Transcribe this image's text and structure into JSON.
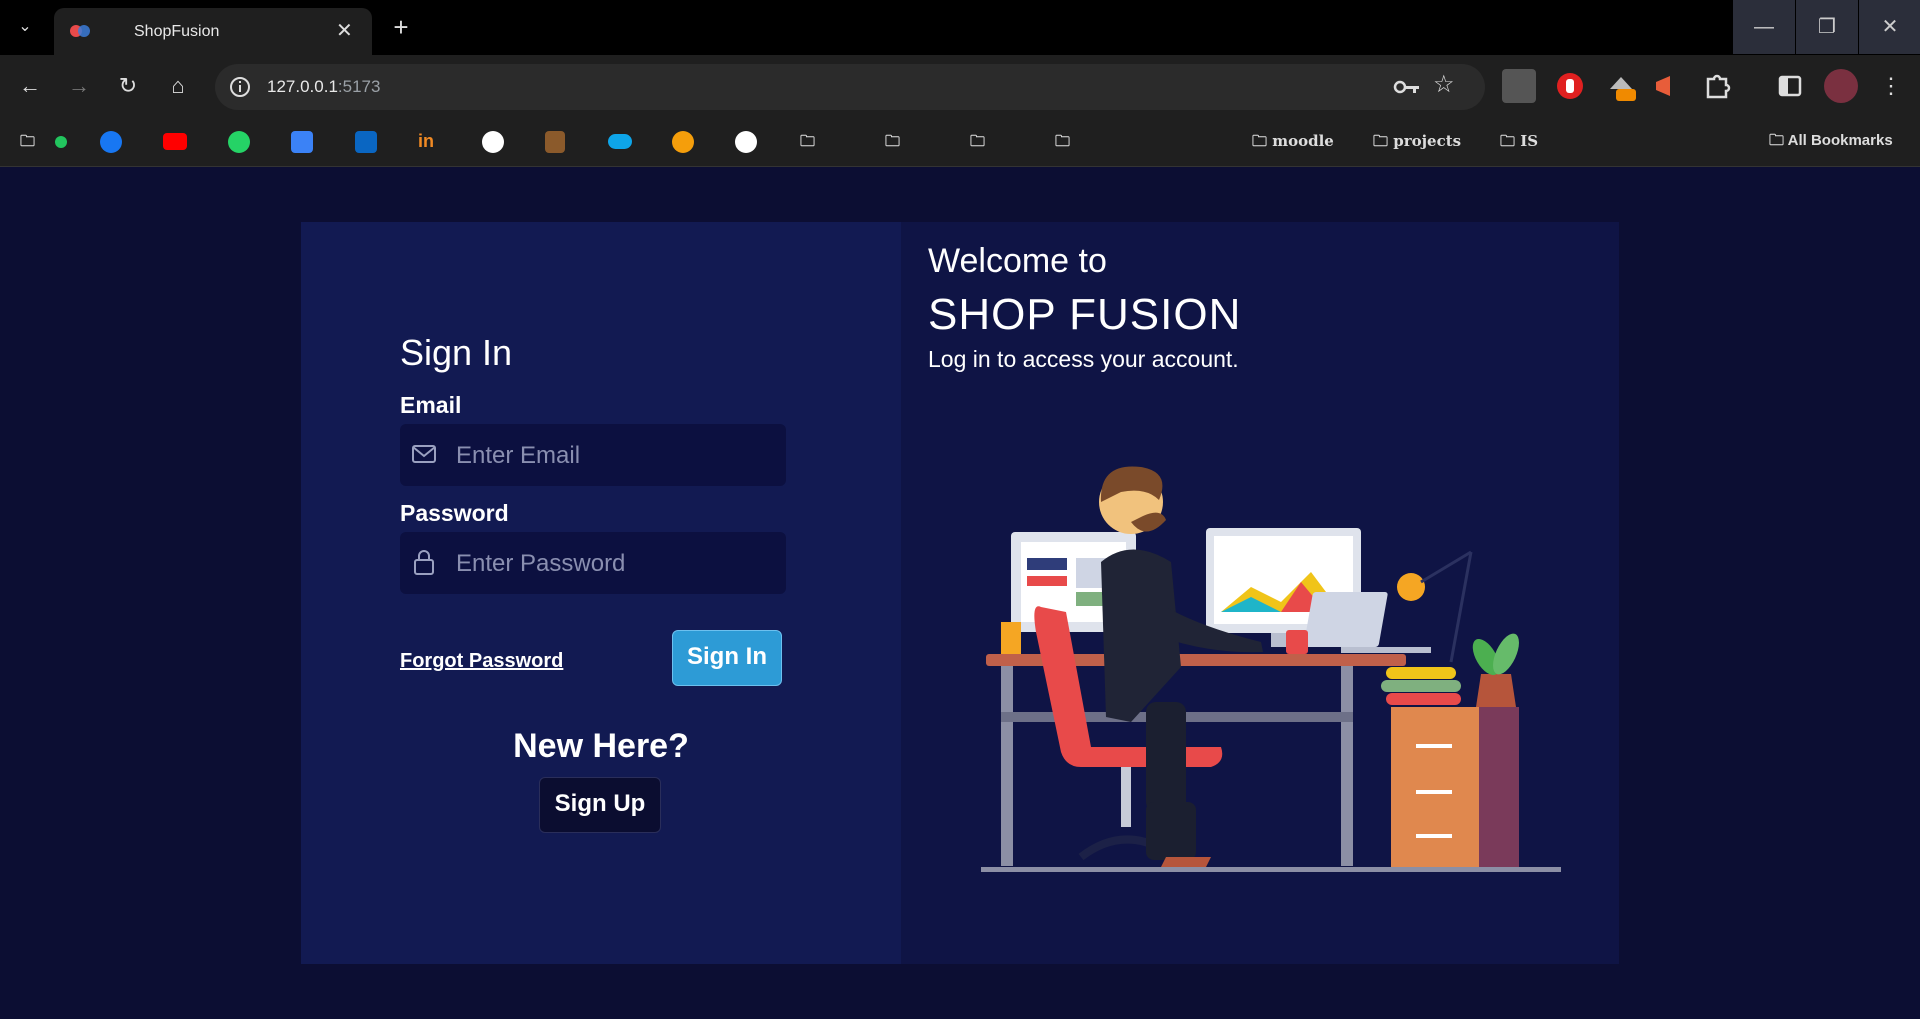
{
  "browser": {
    "tab_title": "ShopFusion",
    "tab_close": "✕",
    "new_tab": "+",
    "url_host": "127.0.0.1",
    "url_port": ":5173",
    "window_controls": {
      "minimize": "—",
      "restore": "❐",
      "close": "✕"
    },
    "bookmarks": {
      "folders": [
        "moodle",
        "projects",
        "IS"
      ],
      "all_bookmarks": "All Bookmarks"
    }
  },
  "signin": {
    "heading": "Sign In",
    "email_label": "Email",
    "email_placeholder": "Enter Email",
    "password_label": "Password",
    "password_placeholder": "Enter Password",
    "forgot_link": "Forgot Password",
    "signin_button": "Sign In",
    "new_here": "New Here?",
    "signup_button": "Sign Up"
  },
  "welcome": {
    "line1": "Welcome to",
    "brand": "SHOP FUSION",
    "tagline": "Log in to access your account.",
    "illustration": "person-working-at-desk-illustration"
  },
  "colors": {
    "page_bg": "#0c0e33",
    "left_panel": "#121a52",
    "right_panel": "#0f1445",
    "primary_button": "#2d9bd6"
  }
}
